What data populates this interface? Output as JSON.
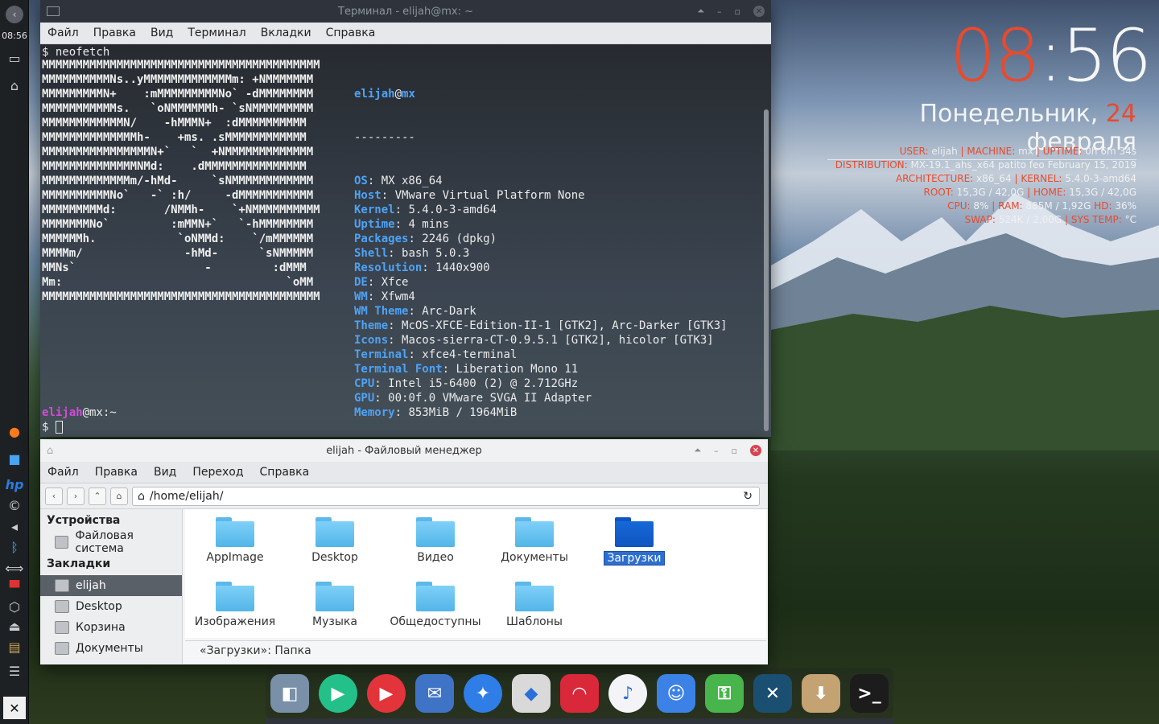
{
  "panel": {
    "time": "08:56"
  },
  "terminal": {
    "title": "Терминал - elijah@mx: ~",
    "menu": [
      "Файл",
      "Правка",
      "Вид",
      "Терминал",
      "Вкладки",
      "Справка"
    ],
    "command_prompt": "$ ",
    "command": "neofetch",
    "logo": [
      "MMMMMMMMMMMMMMMMMMMMMMMMMMMMMMMMMMMMMMMMM",
      "MMMMMMMMMMNs..yMMMMMMMMMMMMMm: +NMMMMMMM",
      "MMMMMMMMMN+    :mMMMMMMMMMNo` -dMMMMMMMM",
      "MMMMMMMMMMMs.   `oNMMMMMMh- `sNMMMMMMMMM",
      "MMMMMMMMMMMMN/    -hMMMN+  :dMMMMMMMMMM",
      "MMMMMMMMMMMMMMh-    +ms. .sMMMMMMMMMMMM",
      "MMMMMMMMMMMMMMMMN+`   `  +NMMMMMMMMMMMMM",
      "MMMMMMMMMMMMMMNMd:    .dMMMMMMMMMMMMMMM",
      "MMMMMMMMMMMMMm/-hMd-     `sNMMMMMMMMMMMM",
      "MMMMMMMMMMNo`   -` :h/     -dMMMMMMMMMMM",
      "MMMMMMMMMd:       /NMMh-    `+NMMMMMMMMMM",
      "MMMMMMMNo`         :mMMN+`   `-hMMMMMMMM",
      "MMMMMMh.            `oNMMd:    `/mMMMMMM",
      "MMMMm/               -hMd-      `sNMMMMM",
      "MMNs`                   -         :dMMM",
      "Mm:                                 `oMM",
      "MMMMMMMMMMMMMMMMMMMMMMMMMMMMMMMMMMMMMMMMM"
    ],
    "user": "elijah",
    "at": "@",
    "host": "mx",
    "sep": "---------",
    "info": [
      [
        "OS",
        "MX x86_64"
      ],
      [
        "Host",
        "VMware Virtual Platform None"
      ],
      [
        "Kernel",
        "5.4.0-3-amd64"
      ],
      [
        "Uptime",
        "4 mins"
      ],
      [
        "Packages",
        "2246 (dpkg)"
      ],
      [
        "Shell",
        "bash 5.0.3"
      ],
      [
        "Resolution",
        "1440x900"
      ],
      [
        "DE",
        "Xfce"
      ],
      [
        "WM",
        "Xfwm4"
      ],
      [
        "WM Theme",
        "Arc-Dark"
      ],
      [
        "Theme",
        "McOS-XFCE-Edition-II-1 [GTK2], Arc-Darker [GTK3]"
      ],
      [
        "Icons",
        "Macos-sierra-CT-0.9.5.1 [GTK2], hicolor [GTK3]"
      ],
      [
        "Terminal",
        "xfce4-terminal"
      ],
      [
        "Terminal Font",
        "Liberation Mono 11"
      ],
      [
        "CPU",
        "Intel i5-6400 (2) @ 2.712GHz"
      ],
      [
        "GPU",
        "00:0f.0 VMware SVGA II Adapter"
      ],
      [
        "Memory",
        "853MiB / 1964MiB"
      ]
    ],
    "prompt_user": "elijah",
    "prompt_host": "@mx:~",
    "prompt_dollar": "$ ",
    "colors": [
      "#000000",
      "#aa0000",
      "#00aa00",
      "#aa5500",
      "#0000aa",
      "#aa00aa",
      "#00aaaa",
      "#aaaaaa",
      "#555555",
      "#ff5555",
      "#55ff55",
      "#ffff55",
      "#5555ff",
      "#ff55ff",
      "#55ffff",
      "#ffffff"
    ]
  },
  "filemanager": {
    "title": "elijah - Файловый менеджер",
    "menu": [
      "Файл",
      "Правка",
      "Вид",
      "Переход",
      "Справка"
    ],
    "path": "/home/elijah/",
    "sidebar": {
      "devices_header": "Устройства",
      "filesystem": "Файловая система",
      "bookmarks_header": "Закладки",
      "items": [
        "elijah",
        "Desktop",
        "Корзина",
        "Документы"
      ]
    },
    "files": [
      "AppImage",
      "Desktop",
      "Видео",
      "Документы",
      "Загрузки",
      "Изображения",
      "Музыка",
      "Общедоступны",
      "Шаблоны"
    ],
    "status": "«Загрузки»: Папка"
  },
  "conky": {
    "hour": "08",
    "colon": ":",
    "minute": "56",
    "weekday": "Понедельник, ",
    "day": "24",
    "month": " февраля",
    "lines": [
      [
        [
          "USER:",
          "l"
        ],
        [
          " elijah ",
          "v"
        ],
        [
          "| MACHINE:",
          "l"
        ],
        [
          " mx ",
          "v"
        ],
        [
          "| UPTIME:",
          "l"
        ],
        [
          " 0h 6m 34s",
          "v"
        ]
      ],
      [
        [
          "DISTRIBUTION:",
          "l"
        ],
        [
          " MX-19.1_ahs_x64 patito feo February 15, 2019",
          "v"
        ]
      ],
      [
        [
          "ARCHITECTURE:",
          "l"
        ],
        [
          " x86_64 ",
          "v"
        ],
        [
          "| KERNEL:",
          "l"
        ],
        [
          " 5.4.0-3-amd64",
          "v"
        ]
      ],
      [
        [
          "ROOT:",
          "l"
        ],
        [
          " 15,3G / 42,0G ",
          "v"
        ],
        [
          "| HOME:",
          "l"
        ],
        [
          " 15,3G / 42,0G",
          "v"
        ]
      ],
      [
        [
          "CPU:",
          "l"
        ],
        [
          " 8% ",
          "v"
        ],
        [
          "| RAM:",
          "l"
        ],
        [
          " 885M / 1,92G ",
          "v"
        ],
        [
          "HD:",
          "l"
        ],
        [
          " 36%",
          "v"
        ]
      ],
      [
        [
          "SWAP:",
          "l"
        ],
        [
          " 524K / 2,00G ",
          "v"
        ],
        [
          "| SYS TEMP:",
          "l"
        ],
        [
          " °C",
          "v"
        ]
      ]
    ]
  },
  "dock": {
    "items": [
      "preview",
      "play",
      "youtube",
      "mail",
      "safari",
      "brave",
      "pinterest",
      "itunes",
      "finder",
      "keepass",
      "xming",
      "archive",
      "terminal"
    ],
    "colors": [
      "#7a8fa8",
      "#24c08a",
      "#e3343b",
      "#3f73c6",
      "#2f7de6",
      "#d9d9d9",
      "#d8283a",
      "#f4f4f8",
      "#3c82e6",
      "#47b54b",
      "#1b4f72",
      "#c4a271",
      "#1c1c1c"
    ]
  }
}
